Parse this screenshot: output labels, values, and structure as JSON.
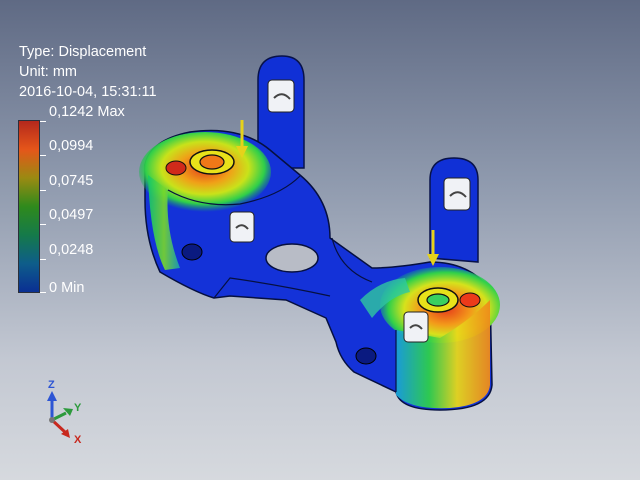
{
  "result": {
    "type_line": "Type: Displacement",
    "unit_line": "Unit: mm",
    "timestamp_line": "2016-10-04, 15:31:11"
  },
  "legend": {
    "max_label": "0,1242 Max",
    "labels": [
      "0,0994",
      "0,0745",
      "0,0497",
      "0,0248"
    ],
    "min_label": "0 Min",
    "gradient_colors": [
      "#b4281c",
      "#e5561a",
      "#9a8a12",
      "#2f8a1c",
      "#157a4a",
      "#0e5d8a",
      "#0a2f93"
    ]
  },
  "triad": {
    "z_label": "Z",
    "y_label": "Y",
    "x_label": "X",
    "colors": {
      "z": "#2d55d4",
      "y": "#2c9a3c",
      "x": "#c8281e"
    }
  },
  "colors": {
    "low": "#0f2fd0",
    "high": "#d8261a",
    "load_arrow": "#e6d21a"
  }
}
